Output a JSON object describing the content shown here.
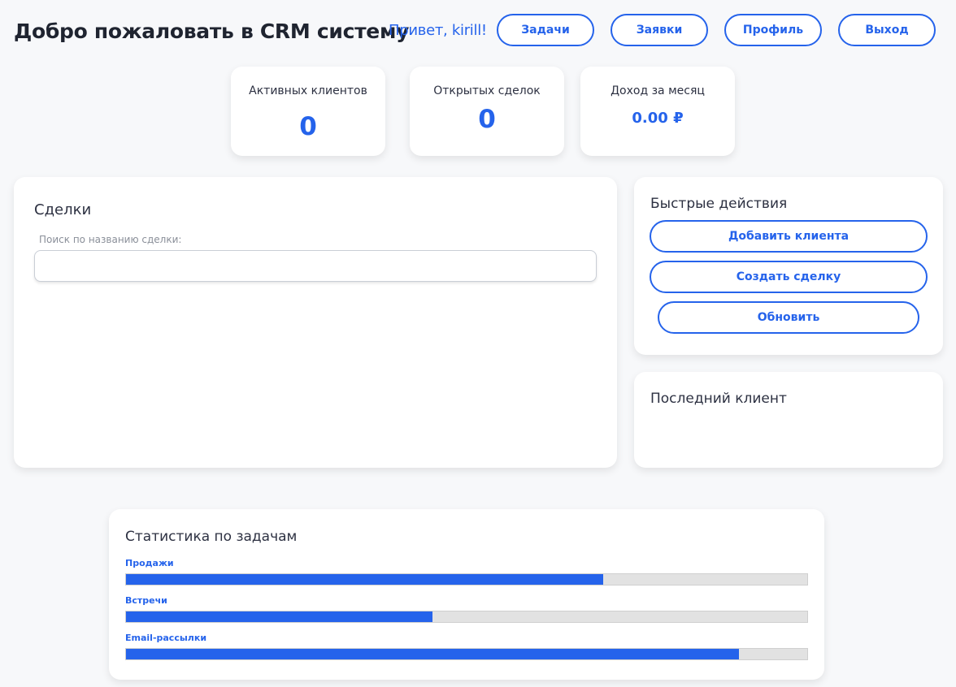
{
  "header": {
    "title": "Добро пожаловать в CRM систему",
    "greeting": "Привет, kirill!",
    "nav": [
      {
        "label": "Задачи"
      },
      {
        "label": "Заявки"
      },
      {
        "label": "Профиль"
      },
      {
        "label": "Выход"
      }
    ]
  },
  "stats": [
    {
      "label": "Активных клиентов",
      "value": "0"
    },
    {
      "label": "Открытых сделок",
      "value": "0"
    },
    {
      "label": "Доход за месяц",
      "value": "0.00 ₽"
    }
  ],
  "deals": {
    "title": "Сделки",
    "search_label": "Поиск по названию сделки:",
    "search_value": ""
  },
  "quick_actions": {
    "title": "Быстрые действия",
    "buttons": [
      {
        "label": "Добавить клиента"
      },
      {
        "label": "Создать сделку"
      },
      {
        "label": "Обновить"
      }
    ]
  },
  "last_client": {
    "title": "Последний клиент"
  },
  "task_stats": {
    "title": "Статистика по задачам",
    "bars": [
      {
        "label": "Продажи",
        "progress": 0.7
      },
      {
        "label": "Встречи",
        "progress": 0.45
      },
      {
        "label": "Email-рассылки",
        "progress": 0.9
      }
    ]
  },
  "colors": {
    "accent": "#2563eb",
    "background": "#f7f8fa",
    "card": "#ffffff",
    "track": "#e2e2e2"
  }
}
